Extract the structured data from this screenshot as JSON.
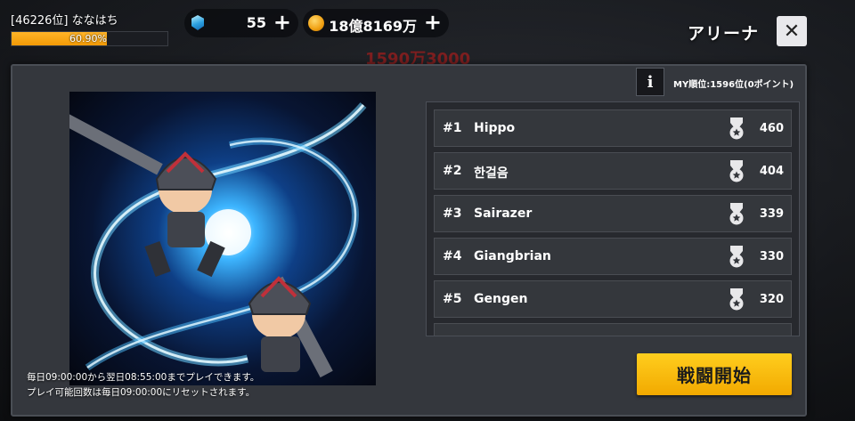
{
  "player": {
    "label": "[46226位] ななはち",
    "exp_percent_text": "60.90%",
    "exp_fraction": 0.609
  },
  "currency": {
    "gems": {
      "icon": "gem-icon",
      "value": "55"
    },
    "gold": {
      "icon": "gold-coin-icon",
      "value": "18億8169万"
    },
    "plus_glyph": "+"
  },
  "header": {
    "title": "アリーナ",
    "close_glyph": "✕"
  },
  "background_text": "1590万3000",
  "info": {
    "glyph": "i",
    "my_rank": "MY順位:1596位(0ポイント)"
  },
  "ranking": [
    {
      "rank": "#1",
      "name": "Hippo",
      "score": "460"
    },
    {
      "rank": "#2",
      "name": "한걸음",
      "score": "404"
    },
    {
      "rank": "#3",
      "name": "Sairazer",
      "score": "339"
    },
    {
      "rank": "#4",
      "name": "Giangbrian",
      "score": "330"
    },
    {
      "rank": "#5",
      "name": "Gengen",
      "score": "320"
    }
  ],
  "notice": {
    "line1": "毎日09:00:00から翌日08:55:00までプレイできます。",
    "line2": "プレイ可能回数は毎日09:00:00にリセットされます。"
  },
  "battle_button": "戦闘開始",
  "colors": {
    "accent": "#f5b000",
    "exp_fill": "#f29a06",
    "panel": "#34373d"
  }
}
